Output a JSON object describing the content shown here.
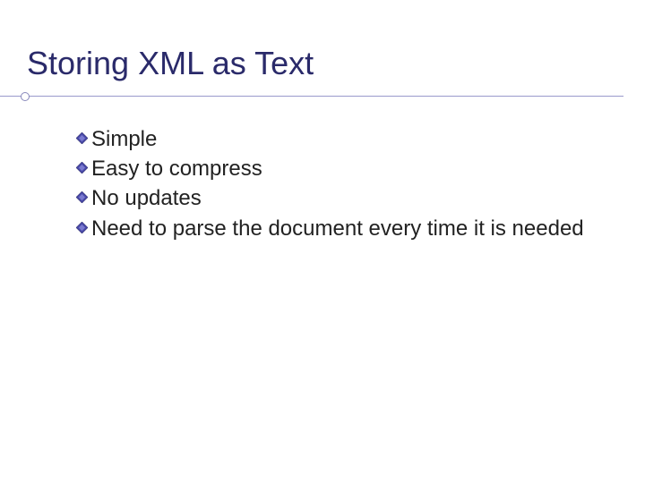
{
  "slide": {
    "title": "Storing XML as Text",
    "bullets": [
      "Simple",
      "Easy to compress",
      "No updates",
      "Need to parse the document every time it is needed"
    ]
  }
}
